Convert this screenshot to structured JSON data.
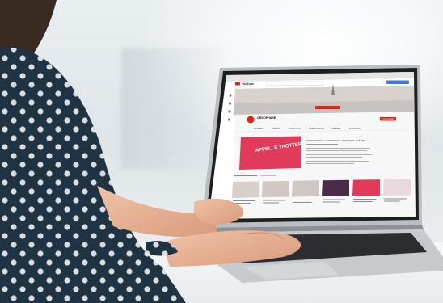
{
  "scene": {
    "description_tags": [
      "photo",
      "laptop",
      "hands-typing",
      "office"
    ]
  },
  "screen": {
    "site_logo": "YouTube",
    "channel_name": "ORDOPHASE",
    "tabs": [
      "ACCUEIL",
      "VIDÉOS",
      "PLAYLISTS",
      "COMMUNAUTÉ",
      "CHAÎNES",
      "À PROPOS"
    ],
    "subscribe_label": "S'ABONNER",
    "featured_thumb_text": "APPELLE TROTTER",
    "featured_title": "Communication: compétences et stratégie en 7 clés",
    "colors": {
      "youtube_red": "#e62117",
      "thumb_pink": "#e23a5a",
      "banner": "#c9c3c0"
    }
  }
}
